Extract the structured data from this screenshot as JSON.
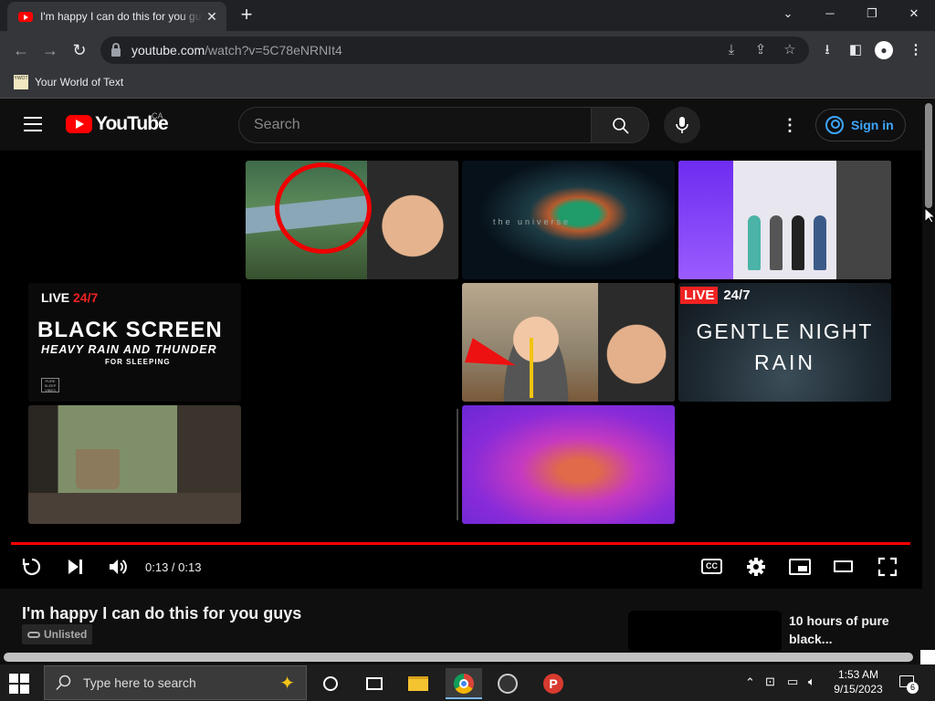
{
  "browser": {
    "tab_title": "I'm happy I can do this for you guys",
    "url_host": "youtube.com",
    "url_path": "/watch?v=5C78eNRNIt4",
    "bookmark": "Your World of Text",
    "bookmark_icon_text": "YWOT"
  },
  "youtube": {
    "logo_text": "YouTube",
    "country": "CA",
    "search_placeholder": "Search",
    "signin_label": "Sign in",
    "brand_red": "#ff0000",
    "link_blue": "#3ea6ff"
  },
  "endscreen": {
    "tile4": {
      "live": "LIVE",
      "live_suffix": "24/7",
      "line1": "BLACK SCREEN",
      "line2": "HEAVY RAIN AND THUNDER",
      "line3": "FOR SLEEPING",
      "logo": "PURE SLEEP VIBES"
    },
    "tile6": {
      "live": "LIVE",
      "live_suffix": "24/7",
      "line1": "GENTLE NIGHT",
      "line2": "RAIN"
    },
    "tile2": {
      "caption": "the universe"
    }
  },
  "player": {
    "time": "0:13 / 0:13",
    "cc": "CC",
    "progress_fraction": 1.0
  },
  "video": {
    "title": "I'm happy I can do this for you guys",
    "visibility": "Unlisted"
  },
  "recommendation": {
    "title": "10 hours of pure black..."
  },
  "taskbar": {
    "search_placeholder": "Type here to search",
    "time": "1:53 AM",
    "date": "9/15/2023",
    "notification_count": "6"
  }
}
